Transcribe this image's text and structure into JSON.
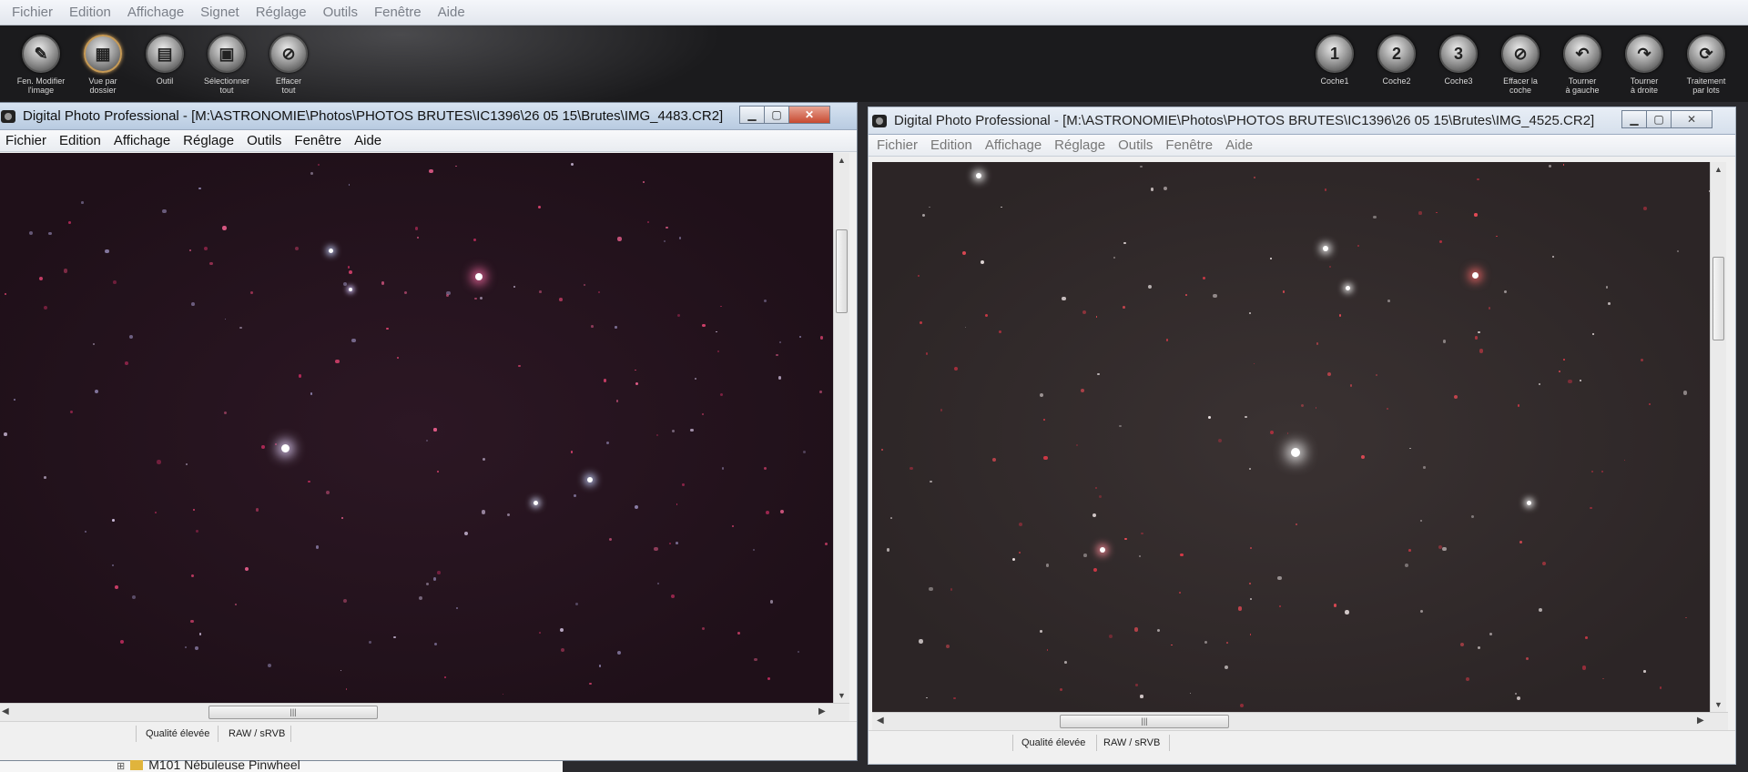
{
  "app_menu": [
    "Fichier",
    "Edition",
    "Affichage",
    "Signet",
    "Réglage",
    "Outils",
    "Fenêtre",
    "Aide"
  ],
  "toolbar_left": [
    {
      "label": "Fen. Modifier\nl'image",
      "icon": "edit-image-icon",
      "glyph": "✎"
    },
    {
      "label": "Vue par\ndossier",
      "icon": "folder-view-icon",
      "glyph": "▦"
    },
    {
      "label": "Outil",
      "icon": "tool-palette-icon",
      "glyph": "▤"
    },
    {
      "label": "Sélectionner\ntout",
      "icon": "select-all-icon",
      "glyph": "▣"
    },
    {
      "label": "Effacer\ntout",
      "icon": "clear-all-icon",
      "glyph": "⊘"
    }
  ],
  "toolbar_right": [
    {
      "label": "Coche1",
      "icon": "check-mark-1-icon",
      "glyph": "1"
    },
    {
      "label": "Coche2",
      "icon": "check-mark-2-icon",
      "glyph": "2"
    },
    {
      "label": "Coche3",
      "icon": "check-mark-3-icon",
      "glyph": "3"
    },
    {
      "label": "Effacer la\ncoche",
      "icon": "clear-check-icon",
      "glyph": "⊘"
    },
    {
      "label": "Tourner\nà gauche",
      "icon": "rotate-left-icon",
      "glyph": "↶"
    },
    {
      "label": "Tourner\nà droite",
      "icon": "rotate-right-icon",
      "glyph": "↷"
    },
    {
      "label": "Traitement\npar lots",
      "icon": "batch-process-icon",
      "glyph": "⟳"
    }
  ],
  "window1": {
    "title": "Digital Photo Professional - [M:\\ASTRONOMIE\\Photos\\PHOTOS BRUTES\\IC1396\\26 05 15\\Brutes\\IMG_4483.CR2]",
    "menu": [
      "Fichier",
      "Edition",
      "Affichage",
      "Réglage",
      "Outils",
      "Fenêtre",
      "Aide"
    ],
    "status": {
      "quality": "Qualité élevée",
      "format": "RAW / sRVB"
    }
  },
  "window2": {
    "title": "Digital Photo Professional - [M:\\ASTRONOMIE\\Photos\\PHOTOS BRUTES\\IC1396\\26 05 15\\Brutes\\IMG_4525.CR2]",
    "menu": [
      "Fichier",
      "Edition",
      "Affichage",
      "Réglage",
      "Outils",
      "Fenêtre",
      "Aide"
    ],
    "status": {
      "quality": "Qualité élevée",
      "format": "RAW / sRVB"
    }
  },
  "background_item": "M101 Nébuleuse Pinwheel",
  "colors": {
    "star_white": "#ffffff",
    "star_red": "#e0405a",
    "star_pink": "#ff6fa8"
  }
}
